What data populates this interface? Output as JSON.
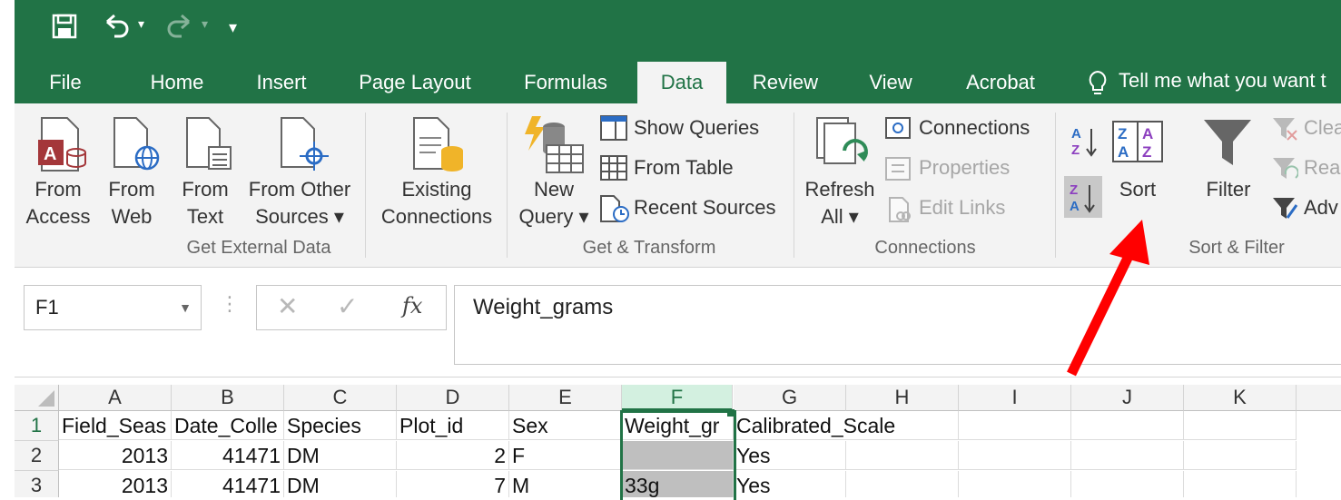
{
  "quick_access": {
    "save_icon": "save-icon",
    "undo_icon": "undo-icon",
    "redo_icon": "redo-icon",
    "customize": "▾"
  },
  "tabs": [
    {
      "label": "File"
    },
    {
      "label": "Home"
    },
    {
      "label": "Insert"
    },
    {
      "label": "Page Layout"
    },
    {
      "label": "Formulas"
    },
    {
      "label": "Data",
      "active": true
    },
    {
      "label": "Review"
    },
    {
      "label": "View"
    },
    {
      "label": "Acrobat"
    }
  ],
  "tell_me": "Tell me what you want t",
  "ribbon": {
    "get_external": {
      "label": "Get External Data",
      "from_access": [
        "From",
        "Access"
      ],
      "from_web": [
        "From",
        "Web"
      ],
      "from_text": [
        "From",
        "Text"
      ],
      "from_other": [
        "From Other",
        "Sources ▾"
      ]
    },
    "existing": [
      "Existing",
      "Connections"
    ],
    "transform": {
      "label": "Get & Transform",
      "new_query": [
        "New",
        "Query ▾"
      ],
      "show_queries": "Show Queries",
      "from_table": "From Table",
      "recent_sources": "Recent Sources"
    },
    "connections": {
      "label": "Connections",
      "refresh": [
        "Refresh",
        "All ▾"
      ],
      "connections": "Connections",
      "properties": "Properties",
      "edit_links": "Edit Links"
    },
    "sort_filter": {
      "label": "Sort & Filter",
      "sort": "Sort",
      "filter": "Filter",
      "clear": "Clea",
      "reapply": "Reap",
      "advanced": "Adv"
    }
  },
  "formula_bar": {
    "name_box": "F1",
    "fx": "fx",
    "formula": "Weight_grams"
  },
  "columns": [
    "A",
    "B",
    "C",
    "D",
    "E",
    "F",
    "G",
    "H",
    "I",
    "J",
    "K"
  ],
  "rows": [
    {
      "num": "1",
      "cells": [
        "Field_Seas",
        "Date_Colle",
        "Species",
        "Plot_id",
        "Sex",
        "Weight_gr",
        "Calibrated_Scale",
        "",
        "",
        "",
        ""
      ]
    },
    {
      "num": "2",
      "cells": [
        "2013",
        "41471",
        "DM",
        "2",
        "F",
        "",
        "Yes",
        "",
        "",
        "",
        ""
      ]
    },
    {
      "num": "3",
      "cells": [
        "2013",
        "41471",
        "DM",
        "7",
        "M",
        "33g",
        "Yes",
        "",
        "",
        "",
        ""
      ]
    }
  ],
  "colors": {
    "accent": "#217346",
    "annotation_arrow": "#ff0000",
    "highlight": "#bfbfbf"
  }
}
